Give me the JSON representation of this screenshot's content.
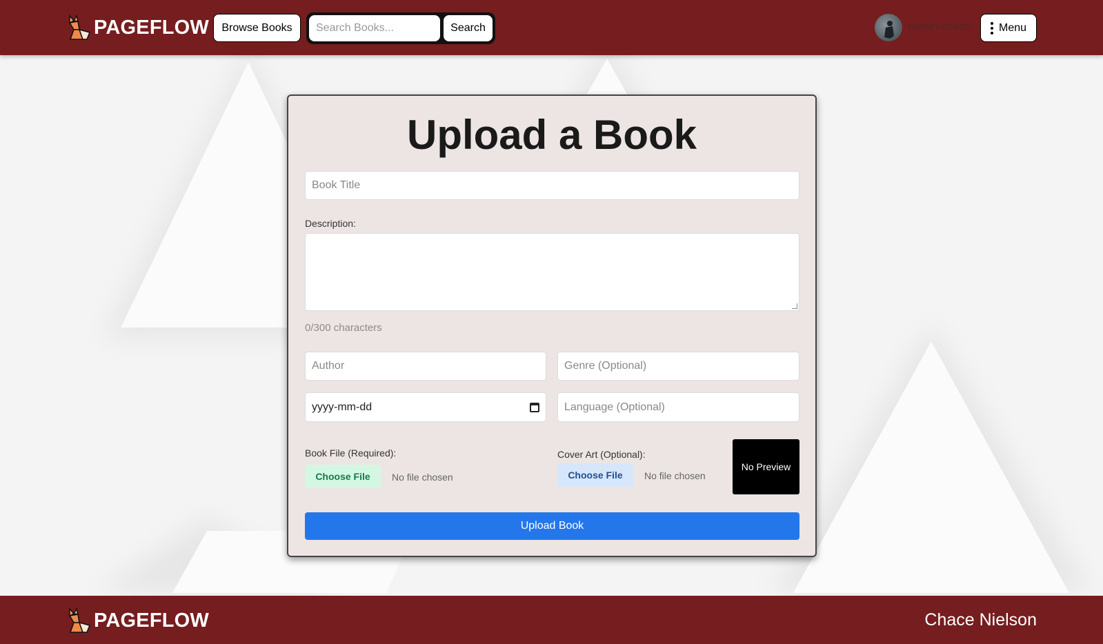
{
  "colors": {
    "header_bg": "#761d1f",
    "card_bg": "#ece5e4",
    "primary_button": "#2377eb",
    "book_file_button_bg": "#d4f7e4",
    "cover_file_button_bg": "#d7e7fb"
  },
  "header": {
    "brand": "PAGEFLOW",
    "logo_icon": "fox-icon",
    "browse_label": "Browse Books",
    "search_placeholder": "Search Books...",
    "search_label": "Search",
    "username": "admin-chace",
    "menu_icon": "kebab-icon",
    "menu_label": "Menu"
  },
  "form": {
    "title": "Upload a Book",
    "book_title_placeholder": "Book Title",
    "description_label": "Description:",
    "char_count": "0/300 characters",
    "author_placeholder": "Author",
    "genre_placeholder": "Genre (Optional)",
    "date_placeholder": "yyyy-mm-dd",
    "date_icon": "calendar-icon",
    "language_placeholder": "Language (Optional)",
    "book_file_label": "Book File (Required):",
    "cover_label": "Cover Art (Optional):",
    "choose_file_label": "Choose File",
    "no_file_label": "No file chosen",
    "preview_text": "No Preview",
    "submit_label": "Upload Book"
  },
  "footer": {
    "brand": "PAGEFLOW",
    "author_name": "Chace Nielson"
  }
}
